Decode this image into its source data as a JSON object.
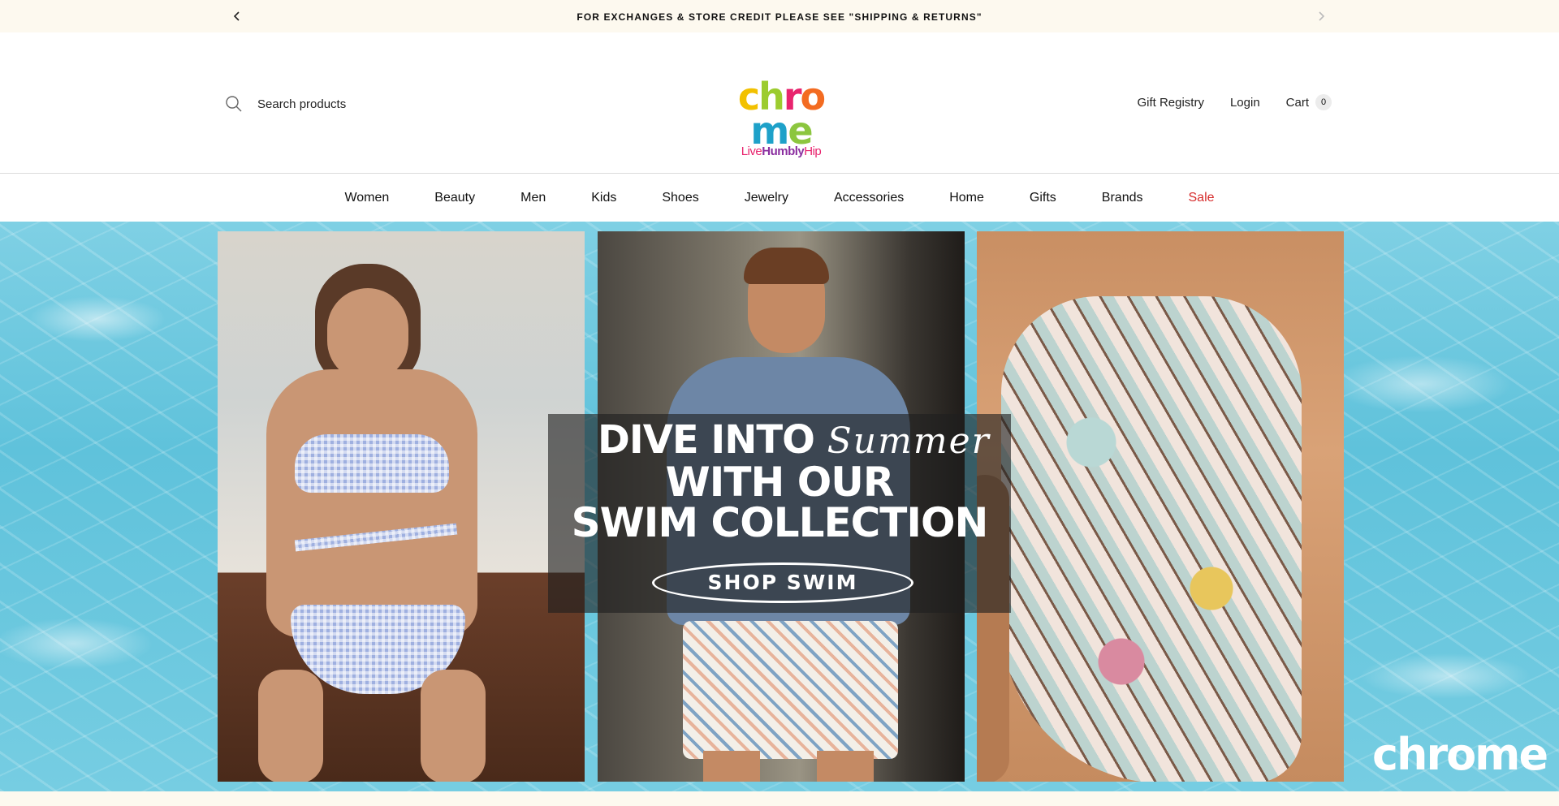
{
  "announcement": {
    "message": "FOR EXCHANGES & STORE CREDIT PLEASE SEE \"SHIPPING & RETURNS\"",
    "prev_icon": "chevron-left-icon",
    "next_icon": "chevron-right-icon"
  },
  "search": {
    "placeholder": "Search products",
    "icon": "search-icon"
  },
  "logo": {
    "word": "chrome",
    "letters": [
      "c",
      "h",
      "r",
      "o",
      "m",
      "e"
    ],
    "letter_colors": [
      "#f2c100",
      "#9ccc2f",
      "#e8246e",
      "#f36b21",
      "#1ea1c9",
      "#8cc63f"
    ],
    "tagline_live": "Live",
    "tagline_humbly": "Humbly",
    "tagline_hip": "Hip",
    "tagline_colors": [
      "#e8246e",
      "#8b2fa0",
      "#e8246e"
    ]
  },
  "utility": {
    "gift_registry": "Gift Registry",
    "login": "Login",
    "cart": "Cart",
    "cart_count": "0"
  },
  "nav": {
    "items": [
      "Women",
      "Beauty",
      "Men",
      "Kids",
      "Shoes",
      "Jewelry",
      "Accessories",
      "Home",
      "Gifts",
      "Brands",
      "Sale"
    ]
  },
  "hero": {
    "line1": "DIVE INTO",
    "script": "Summer",
    "line2": "WITH OUR",
    "line3": "SWIM COLLECTION",
    "cta": "SHOP SWIM",
    "watermark": "chrome"
  },
  "colors": {
    "announcement_bg": "#fdf9ef",
    "sale": "#d62b2b",
    "pool": "#6ec8df"
  }
}
